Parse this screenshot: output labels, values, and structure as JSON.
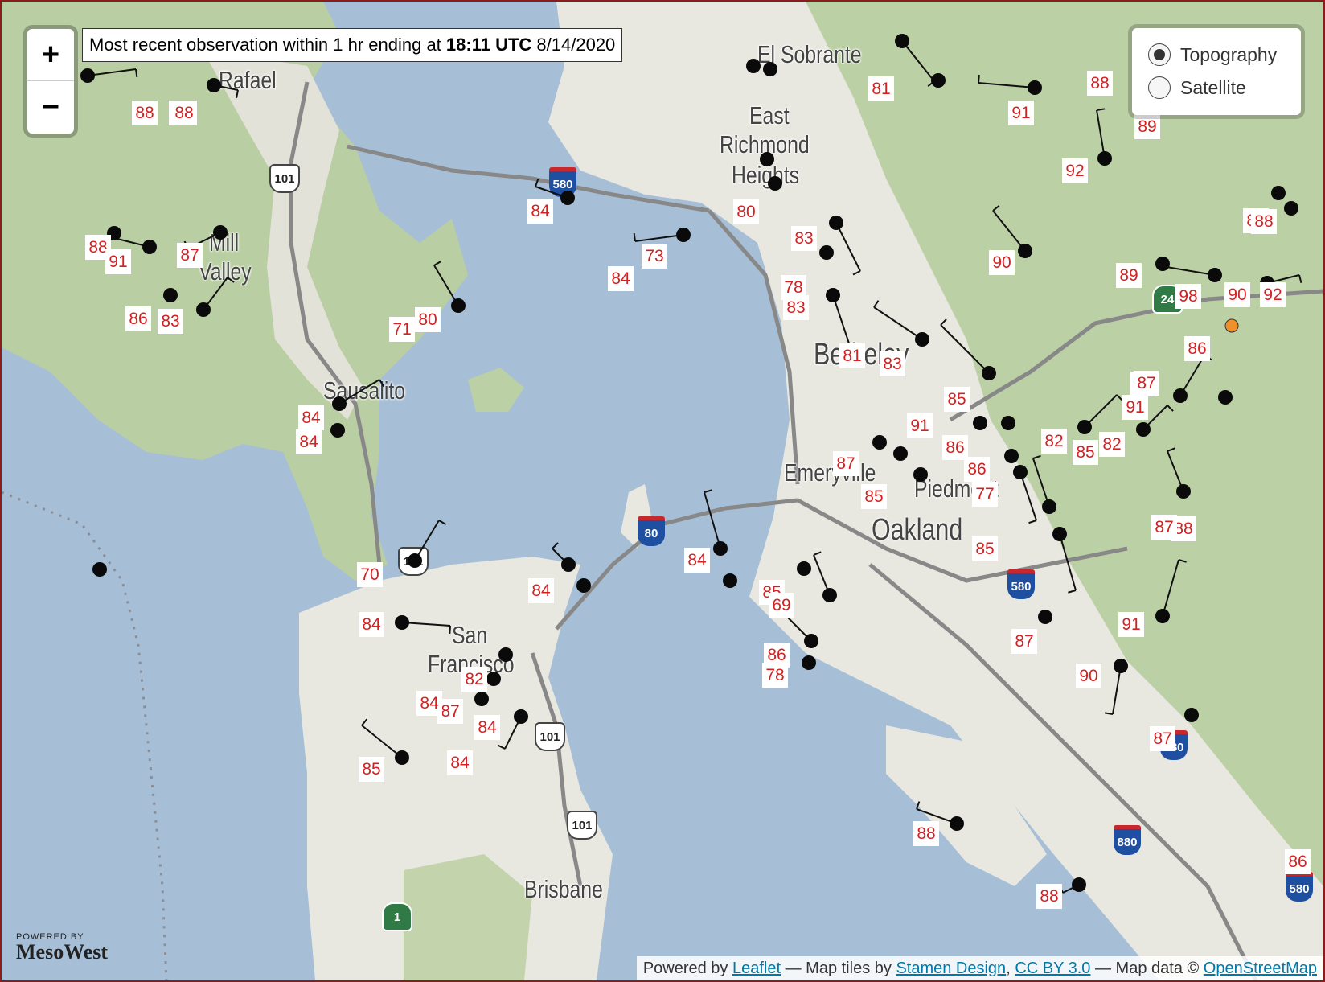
{
  "map": {
    "title_prefix": "Most recent observation within 1 hr ending at ",
    "title_time": "18:11 UTC",
    "title_date": " 8/14/2020",
    "colors": {
      "water": "#a7bfd6",
      "land": "#e8e7e0",
      "hills": "#bcd0a6",
      "temp_text": "#d42020",
      "station_outlier": "#f0902a",
      "roads": "#888888"
    }
  },
  "controls": {
    "zoom_in_label": "+",
    "zoom_out_label": "−",
    "layers": [
      {
        "label": "Topography",
        "selected": true
      },
      {
        "label": "Satellite",
        "selected": false
      }
    ]
  },
  "attribution": {
    "powered_by": "Powered by ",
    "leaflet": "Leaflet",
    "sep1": " — Map tiles by ",
    "stamen": "Stamen Design",
    "comma": ", ",
    "cc": "CC BY 3.0",
    "sep2": " — Map data © ",
    "osm": "OpenStreetMap"
  },
  "logo": {
    "powered": "POWERED BY",
    "name": "MesoWest"
  },
  "places": [
    {
      "name": "Rafael",
      "big": false
    },
    {
      "name": "El Sobrante",
      "big": false
    },
    {
      "name": "East",
      "big": false
    },
    {
      "name": "Richmond",
      "big": false
    },
    {
      "name": "Heights",
      "big": false
    },
    {
      "name": "Mill",
      "big": false
    },
    {
      "name": "Valley",
      "big": false
    },
    {
      "name": "Sausalito",
      "big": false
    },
    {
      "name": "Berkeley",
      "big": true
    },
    {
      "name": "Emeryville",
      "big": false
    },
    {
      "name": "Piedmont",
      "big": false
    },
    {
      "name": "Oakland",
      "big": true
    },
    {
      "name": "San",
      "big": false
    },
    {
      "name": "Francisco",
      "big": false
    },
    {
      "name": "Brisbane",
      "big": false
    }
  ],
  "route_shields": [
    {
      "label": "101",
      "kind": "us"
    },
    {
      "label": "101",
      "kind": "us"
    },
    {
      "label": "101",
      "kind": "us"
    },
    {
      "label": "101",
      "kind": "us"
    },
    {
      "label": "580",
      "kind": "i"
    },
    {
      "label": "580",
      "kind": "i"
    },
    {
      "label": "580",
      "kind": "i"
    },
    {
      "label": "580",
      "kind": "i"
    },
    {
      "label": "80",
      "kind": "i"
    },
    {
      "label": "880",
      "kind": "i"
    },
    {
      "label": "24",
      "kind": "ca"
    },
    {
      "label": "1",
      "kind": "ca"
    }
  ],
  "temperatures": [
    "88",
    "89",
    "88",
    "88",
    "91",
    "87",
    "86",
    "83",
    "84",
    "73",
    "84",
    "80",
    "71",
    "84",
    "84",
    "84",
    "70",
    "84",
    "85",
    "84",
    "82",
    "87",
    "84",
    "84",
    "85",
    "84",
    "69",
    "86",
    "78",
    "80",
    "78",
    "83",
    "83",
    "81",
    "83",
    "85",
    "91",
    "86",
    "87",
    "85",
    "77",
    "86",
    "82",
    "85",
    "82",
    "85",
    "87",
    "87",
    "91",
    "88",
    "91",
    "88",
    "92",
    "90",
    "89",
    "98",
    "90",
    "86",
    "87",
    "87",
    "91",
    "90",
    "87",
    "88",
    "88",
    "86",
    "82",
    "81",
    "89",
    "92",
    "88",
    "89"
  ]
}
